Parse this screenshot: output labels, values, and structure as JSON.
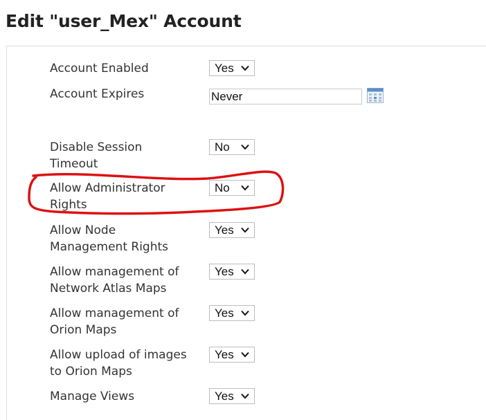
{
  "page": {
    "title": "Edit \"user_Mex\" Account"
  },
  "icons": {
    "calendar": "calendar-icon",
    "dropdown": "chevron-down-icon"
  },
  "colors": {
    "highlight_annotation": "#dd1111",
    "calendar_accent": "#5b8fc7"
  },
  "settings": [
    {
      "label": "Account Enabled",
      "value": "Yes"
    },
    {
      "label": "Account Expires",
      "value": "Never"
    },
    {
      "label": "Disable Session Timeout",
      "value": "No"
    },
    {
      "label": "Allow Administrator Rights",
      "value": "No"
    },
    {
      "label": "Allow Node Management Rights",
      "value": "Yes"
    },
    {
      "label": "Allow management of Network Atlas Maps",
      "value": "Yes"
    },
    {
      "label": "Allow management of Orion Maps",
      "value": "Yes"
    },
    {
      "label": "Allow upload of images to Orion Maps",
      "value": "Yes"
    },
    {
      "label": "Manage Views",
      "value": "Yes"
    }
  ]
}
